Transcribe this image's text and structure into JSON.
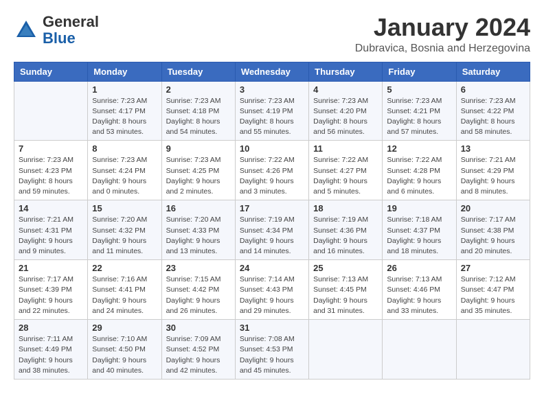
{
  "header": {
    "logo_line1": "General",
    "logo_line2": "Blue",
    "month_title": "January 2024",
    "location": "Dubravica, Bosnia and Herzegovina"
  },
  "weekdays": [
    "Sunday",
    "Monday",
    "Tuesday",
    "Wednesday",
    "Thursday",
    "Friday",
    "Saturday"
  ],
  "weeks": [
    [
      {
        "day": "",
        "info": ""
      },
      {
        "day": "1",
        "info": "Sunrise: 7:23 AM\nSunset: 4:17 PM\nDaylight: 8 hours\nand 53 minutes."
      },
      {
        "day": "2",
        "info": "Sunrise: 7:23 AM\nSunset: 4:18 PM\nDaylight: 8 hours\nand 54 minutes."
      },
      {
        "day": "3",
        "info": "Sunrise: 7:23 AM\nSunset: 4:19 PM\nDaylight: 8 hours\nand 55 minutes."
      },
      {
        "day": "4",
        "info": "Sunrise: 7:23 AM\nSunset: 4:20 PM\nDaylight: 8 hours\nand 56 minutes."
      },
      {
        "day": "5",
        "info": "Sunrise: 7:23 AM\nSunset: 4:21 PM\nDaylight: 8 hours\nand 57 minutes."
      },
      {
        "day": "6",
        "info": "Sunrise: 7:23 AM\nSunset: 4:22 PM\nDaylight: 8 hours\nand 58 minutes."
      }
    ],
    [
      {
        "day": "7",
        "info": "Sunrise: 7:23 AM\nSunset: 4:23 PM\nDaylight: 8 hours\nand 59 minutes."
      },
      {
        "day": "8",
        "info": "Sunrise: 7:23 AM\nSunset: 4:24 PM\nDaylight: 9 hours\nand 0 minutes."
      },
      {
        "day": "9",
        "info": "Sunrise: 7:23 AM\nSunset: 4:25 PM\nDaylight: 9 hours\nand 2 minutes."
      },
      {
        "day": "10",
        "info": "Sunrise: 7:22 AM\nSunset: 4:26 PM\nDaylight: 9 hours\nand 3 minutes."
      },
      {
        "day": "11",
        "info": "Sunrise: 7:22 AM\nSunset: 4:27 PM\nDaylight: 9 hours\nand 5 minutes."
      },
      {
        "day": "12",
        "info": "Sunrise: 7:22 AM\nSunset: 4:28 PM\nDaylight: 9 hours\nand 6 minutes."
      },
      {
        "day": "13",
        "info": "Sunrise: 7:21 AM\nSunset: 4:29 PM\nDaylight: 9 hours\nand 8 minutes."
      }
    ],
    [
      {
        "day": "14",
        "info": "Sunrise: 7:21 AM\nSunset: 4:31 PM\nDaylight: 9 hours\nand 9 minutes."
      },
      {
        "day": "15",
        "info": "Sunrise: 7:20 AM\nSunset: 4:32 PM\nDaylight: 9 hours\nand 11 minutes."
      },
      {
        "day": "16",
        "info": "Sunrise: 7:20 AM\nSunset: 4:33 PM\nDaylight: 9 hours\nand 13 minutes."
      },
      {
        "day": "17",
        "info": "Sunrise: 7:19 AM\nSunset: 4:34 PM\nDaylight: 9 hours\nand 14 minutes."
      },
      {
        "day": "18",
        "info": "Sunrise: 7:19 AM\nSunset: 4:36 PM\nDaylight: 9 hours\nand 16 minutes."
      },
      {
        "day": "19",
        "info": "Sunrise: 7:18 AM\nSunset: 4:37 PM\nDaylight: 9 hours\nand 18 minutes."
      },
      {
        "day": "20",
        "info": "Sunrise: 7:17 AM\nSunset: 4:38 PM\nDaylight: 9 hours\nand 20 minutes."
      }
    ],
    [
      {
        "day": "21",
        "info": "Sunrise: 7:17 AM\nSunset: 4:39 PM\nDaylight: 9 hours\nand 22 minutes."
      },
      {
        "day": "22",
        "info": "Sunrise: 7:16 AM\nSunset: 4:41 PM\nDaylight: 9 hours\nand 24 minutes."
      },
      {
        "day": "23",
        "info": "Sunrise: 7:15 AM\nSunset: 4:42 PM\nDaylight: 9 hours\nand 26 minutes."
      },
      {
        "day": "24",
        "info": "Sunrise: 7:14 AM\nSunset: 4:43 PM\nDaylight: 9 hours\nand 29 minutes."
      },
      {
        "day": "25",
        "info": "Sunrise: 7:13 AM\nSunset: 4:45 PM\nDaylight: 9 hours\nand 31 minutes."
      },
      {
        "day": "26",
        "info": "Sunrise: 7:13 AM\nSunset: 4:46 PM\nDaylight: 9 hours\nand 33 minutes."
      },
      {
        "day": "27",
        "info": "Sunrise: 7:12 AM\nSunset: 4:47 PM\nDaylight: 9 hours\nand 35 minutes."
      }
    ],
    [
      {
        "day": "28",
        "info": "Sunrise: 7:11 AM\nSunset: 4:49 PM\nDaylight: 9 hours\nand 38 minutes."
      },
      {
        "day": "29",
        "info": "Sunrise: 7:10 AM\nSunset: 4:50 PM\nDaylight: 9 hours\nand 40 minutes."
      },
      {
        "day": "30",
        "info": "Sunrise: 7:09 AM\nSunset: 4:52 PM\nDaylight: 9 hours\nand 42 minutes."
      },
      {
        "day": "31",
        "info": "Sunrise: 7:08 AM\nSunset: 4:53 PM\nDaylight: 9 hours\nand 45 minutes."
      },
      {
        "day": "",
        "info": ""
      },
      {
        "day": "",
        "info": ""
      },
      {
        "day": "",
        "info": ""
      }
    ]
  ]
}
